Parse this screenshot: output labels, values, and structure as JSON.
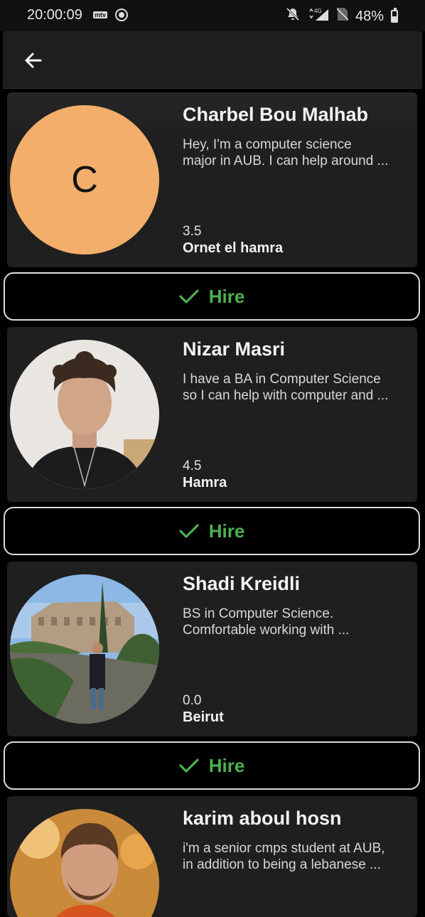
{
  "status_bar": {
    "time": "20:00:09",
    "carrier_badge": "mtv",
    "network": "4G",
    "battery": "48%"
  },
  "app_bar": {
    "back_icon": "arrow-left-icon"
  },
  "helpers": [
    {
      "name": "Charbel Bou Malhab",
      "bio": "Hey, I'm a computer science\nmajor in AUB. I can help around ...",
      "rating": "3.5",
      "location": "Ornet el hamra",
      "avatar_letter": "C",
      "hire_label": "Hire"
    },
    {
      "name": "Nizar Masri",
      "bio": "I have a BA in Computer Science\nso I can help with computer and ...",
      "rating": "4.5",
      "location": "Hamra",
      "hire_label": "Hire"
    },
    {
      "name": "Shadi Kreidli",
      "bio": "BS in Computer Science.\nComfortable working with ...",
      "rating": "0.0",
      "location": "Beirut",
      "hire_label": "Hire"
    },
    {
      "name": "karim aboul hosn",
      "bio": "i'm a senior cmps student at AUB,\nin addition to being a lebanese ...",
      "rating": "",
      "location": ""
    }
  ],
  "colors": {
    "accent_green": "#4caf50",
    "avatar_orange": "#f2ae6a",
    "card_bg": "#1f1f1f"
  }
}
